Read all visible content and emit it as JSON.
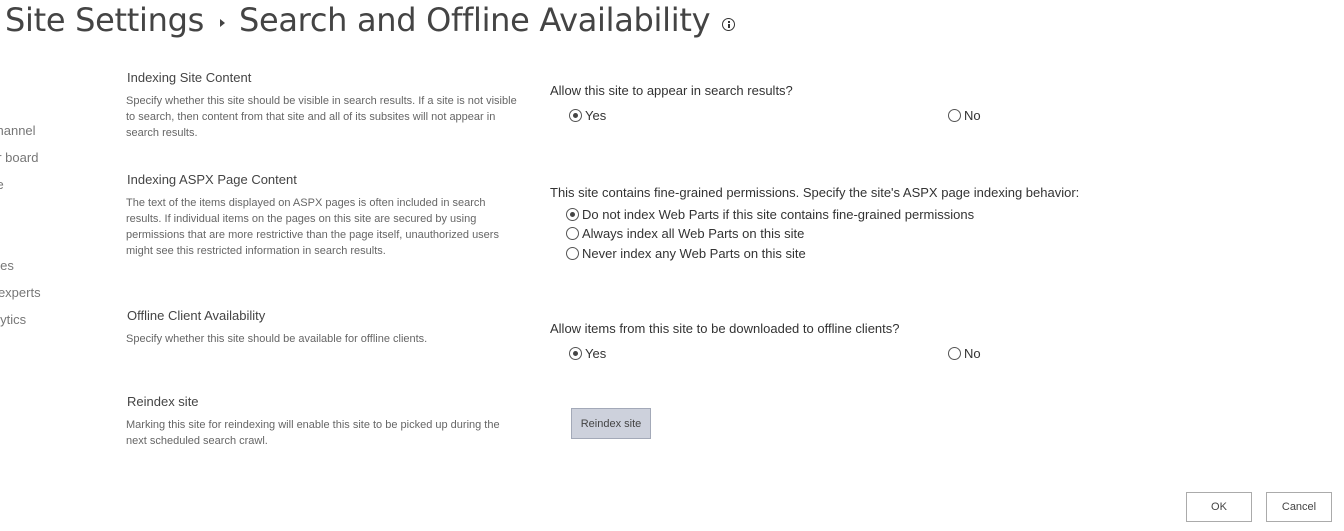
{
  "header": {
    "breadcrumb_root": "Site Settings",
    "page_title": "Search and Offline Availability"
  },
  "left_nav": {
    "items": [
      {
        "label": "r"
      },
      {
        "label": "channel"
      },
      {
        "label": "er board"
      },
      {
        "label": "ite"
      },
      {
        "label": "s"
      },
      {
        "label": "ines"
      },
      {
        "label": "r experts"
      },
      {
        "label": "alytics"
      }
    ]
  },
  "sections": {
    "indexing_site": {
      "title": "Indexing Site Content",
      "description": "Specify whether this site should be visible in search results. If a site is not visible to search, then content from that site and all of its subsites will not appear in search results.",
      "question": "Allow this site to appear in search results?",
      "options": [
        {
          "label": "Yes",
          "checked": true
        },
        {
          "label": "No",
          "checked": false
        }
      ]
    },
    "indexing_aspx": {
      "title": "Indexing ASPX Page Content",
      "description": "The text of the items displayed on ASPX pages is often included in search results. If individual items on the pages on this site are secured by using permissions that are more restrictive than the page itself, unauthorized users might see this restricted information in search results.",
      "question": "This site contains fine-grained permissions. Specify the site's ASPX page indexing behavior:",
      "options": [
        {
          "label": "Do not index Web Parts if this site contains fine-grained permissions",
          "checked": true
        },
        {
          "label": "Always index all Web Parts on this site",
          "checked": false
        },
        {
          "label": "Never index any Web Parts on this site",
          "checked": false
        }
      ]
    },
    "offline": {
      "title": "Offline Client Availability",
      "description": "Specify whether this site should be available for offline clients.",
      "question": "Allow items from this site to be downloaded to offline clients?",
      "options": [
        {
          "label": "Yes",
          "checked": true
        },
        {
          "label": "No",
          "checked": false
        }
      ]
    },
    "reindex": {
      "title": "Reindex site",
      "description": "Marking this site for reindexing will enable this site to be picked up during the next scheduled search crawl.",
      "button_label": "Reindex site"
    }
  },
  "footer": {
    "ok_label": "OK",
    "cancel_label": "Cancel"
  }
}
